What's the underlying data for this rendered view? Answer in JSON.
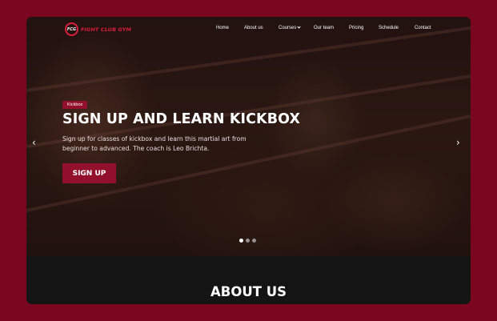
{
  "brand": {
    "badge_text": "FCG",
    "name": "FIGHT CLUB GYM",
    "accent_color": "#93102c",
    "page_background": "#7a0620"
  },
  "nav": {
    "items": [
      {
        "label": "Home"
      },
      {
        "label": "About us"
      },
      {
        "label": "Courses",
        "has_dropdown": true
      },
      {
        "label": "Our team"
      },
      {
        "label": "Pricing"
      },
      {
        "label": "Schedule"
      },
      {
        "label": "Contact"
      }
    ]
  },
  "hero": {
    "tag": "Kickbox",
    "title": "SIGN UP AND LEARN KICKBOX",
    "description": "Sign up for classes of kickbox and learn this martial art from beginner to advanced. The coach is Leo Brichta.",
    "cta_label": "SIGN UP",
    "prev_icon": "chevron-left-icon",
    "next_icon": "chevron-right-icon",
    "slides_total": 3,
    "active_slide": 1
  },
  "about": {
    "title": "ABOUT US"
  }
}
